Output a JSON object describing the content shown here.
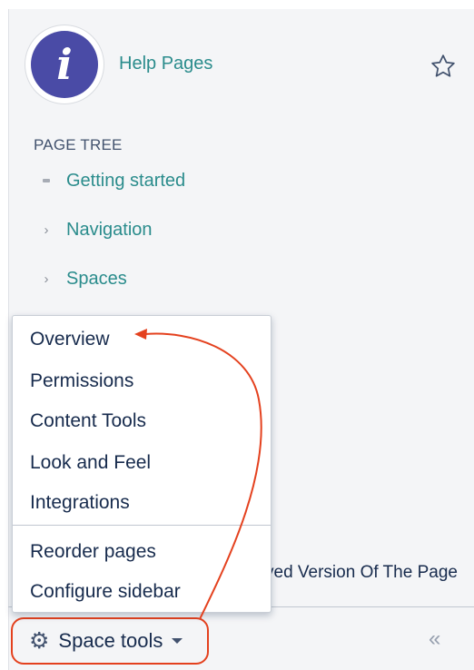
{
  "space": {
    "logo_icon": "info-i-icon",
    "logo_glyph": "i",
    "name": "Help Pages",
    "star_icon": "star-outline-icon"
  },
  "page_tree": {
    "heading": "PAGE TREE",
    "items": [
      {
        "label": "Getting started",
        "marker": "bullet"
      },
      {
        "label": "Navigation",
        "marker": "›"
      },
      {
        "label": "Spaces",
        "marker": "›"
      }
    ]
  },
  "background_text": "ved Version Of The Page",
  "menu": {
    "section1": [
      "Overview",
      "Permissions",
      "Content Tools",
      "Look and Feel",
      "Integrations"
    ],
    "section2": [
      "Reorder pages",
      "Configure sidebar"
    ]
  },
  "footer": {
    "space_tools_label": "Space tools",
    "gear_glyph": "⚙",
    "collapse_glyph": "«"
  },
  "colors": {
    "link": "#2a8c8c",
    "logo": "#4a4ba6",
    "annotation": "#e4411e"
  }
}
